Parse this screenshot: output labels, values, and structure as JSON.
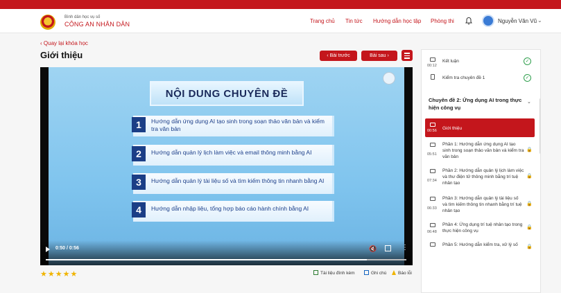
{
  "header": {
    "brand_sub": "Bình dân học vụ số",
    "brand_main": "CÔNG AN NHÂN DÂN",
    "nav": [
      "Trang chủ",
      "Tin tức",
      "Hướng dẫn học tập",
      "Phòng thi"
    ],
    "user_name": "Nguyễn Văn Vũ"
  },
  "page": {
    "back_link": "Quay lại khóa học",
    "title": "Giới thiệu",
    "prev_label": "Bài trước",
    "next_label": "Bài sau"
  },
  "video": {
    "slide_title": "NỘI DUNG CHUYÊN ĐỀ",
    "items": [
      {
        "num": "1",
        "text": "Hướng dẫn ứng dụng AI tạo sinh trong soạn thảo văn bản và kiểm tra văn bản"
      },
      {
        "num": "2",
        "text": "Hướng dẫn quản lý lịch làm việc và email thông minh bằng AI"
      },
      {
        "num": "3",
        "text": "Hướng dẫn quản lý tài liệu số và tìm kiếm thông tin nhanh bằng AI"
      },
      {
        "num": "4",
        "text": "Hướng dẫn nhập liệu, tổng hợp báo cáo hành chính bằng AI"
      }
    ],
    "time": "0:50 / 0:56",
    "progress": 0.89
  },
  "rating": {
    "stars": "★★★★★"
  },
  "tools": {
    "docs": "Tài liệu đính kèm",
    "notes": "Ghi chú",
    "report": "Báo lỗi"
  },
  "sidebar": {
    "top_items": [
      {
        "time": "00:12",
        "label": "Kết luận",
        "status": "✓"
      },
      {
        "time": "",
        "label": "Kiểm tra chuyên đề 1",
        "status": "✓"
      }
    ],
    "section_title": "Chuyên đề 2: Ứng dụng AI trong thực hiện công vụ",
    "lessons": [
      {
        "time": "00:56",
        "label": "Giới thiệu",
        "lock": ""
      },
      {
        "time": "05:51",
        "label": "Phần 1: Hướng dẫn ứng dụng AI tạo sinh trong soạn thảo văn bản và kiểm tra văn bản",
        "lock": "🔒"
      },
      {
        "time": "07:34",
        "label": "Phần 2: Hướng dẫn quản lý lịch làm việc và thư điện tử thông minh bằng trí tuệ nhân tạo",
        "lock": "🔒"
      },
      {
        "time": "06:33",
        "label": "Phần 3: Hướng dẫn quản lý tài liệu số và tìm kiếm thông tin nhanh bằng trí tuệ nhân tạo",
        "lock": "🔒"
      },
      {
        "time": "06:48",
        "label": "Phần 4: Ứng dụng trí tuệ nhân tạo trong thực hiện công vụ",
        "lock": "🔒"
      },
      {
        "time": "",
        "label": "Phần 5: Hướng dẫn kiểm tra, xử lý số",
        "lock": "🔒"
      }
    ]
  },
  "colors": {
    "accent": "#c4161c",
    "success": "#2e9e4c",
    "star": "#f0b400"
  }
}
